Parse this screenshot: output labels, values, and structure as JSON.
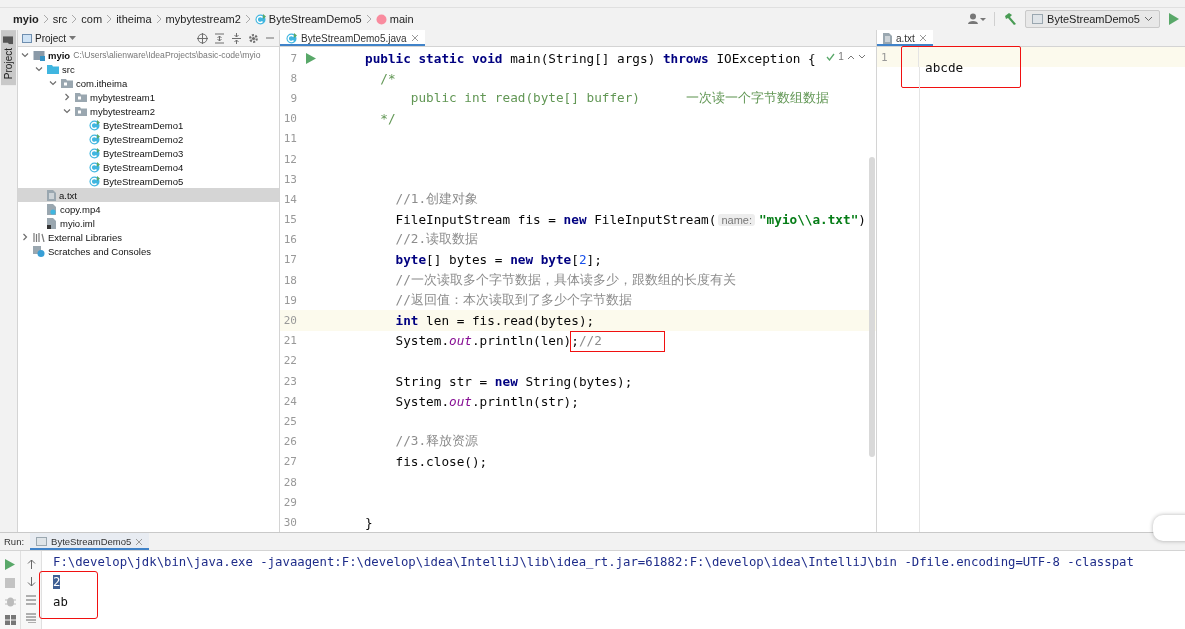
{
  "breadcrumbs": [
    {
      "label": "myio",
      "kind": "module"
    },
    {
      "label": "src",
      "kind": "folder"
    },
    {
      "label": "com",
      "kind": "folder"
    },
    {
      "label": "itheima",
      "kind": "folder"
    },
    {
      "label": "mybytestream2",
      "kind": "folder"
    },
    {
      "label": "ByteStreamDemo5",
      "kind": "class"
    },
    {
      "label": "main",
      "kind": "method"
    }
  ],
  "toolbar": {
    "run_configuration": "ByteStreamDemo5"
  },
  "side_tab": {
    "label": "Project",
    "selected": true
  },
  "project": {
    "title": "Project",
    "tree": [
      {
        "label": "myio",
        "path": "C:\\Users\\alienware\\IdeaProjects\\basic-code\\myio",
        "kind": "module",
        "expanded": true,
        "selected": false,
        "children": [
          {
            "label": "src",
            "kind": "source-folder",
            "expanded": true,
            "selected": false,
            "children": [
              {
                "label": "com.itheima",
                "kind": "package",
                "expanded": true,
                "selected": false,
                "children": [
                  {
                    "label": "mybytestream1",
                    "kind": "package",
                    "expanded": false,
                    "selected": false
                  },
                  {
                    "label": "mybytestream2",
                    "kind": "package",
                    "expanded": true,
                    "selected": false,
                    "children": [
                      {
                        "label": "ByteStreamDemo1",
                        "kind": "class",
                        "selected": false
                      },
                      {
                        "label": "ByteStreamDemo2",
                        "kind": "class",
                        "selected": false
                      },
                      {
                        "label": "ByteStreamDemo3",
                        "kind": "class",
                        "selected": false
                      },
                      {
                        "label": "ByteStreamDemo4",
                        "kind": "class",
                        "selected": false
                      },
                      {
                        "label": "ByteStreamDemo5",
                        "kind": "class",
                        "selected": false
                      }
                    ]
                  }
                ]
              }
            ]
          },
          {
            "label": "a.txt",
            "kind": "text-file",
            "selected": true
          },
          {
            "label": "copy.mp4",
            "kind": "unknown-file",
            "selected": false
          },
          {
            "label": "myio.iml",
            "kind": "module-file",
            "selected": false
          }
        ]
      },
      {
        "label": "External Libraries",
        "kind": "libraries",
        "expanded": false,
        "selected": false
      },
      {
        "label": "Scratches and Consoles",
        "kind": "scratches",
        "selected": false
      }
    ]
  },
  "editor": {
    "tabs": [
      {
        "label": "ByteStreamDemo5.java",
        "selected": true
      }
    ],
    "inspection_count": "1",
    "lines": [
      {
        "number": "7",
        "run": true,
        "current": false,
        "segments": [
          {
            "kind": "keyword",
            "text": "public static void"
          },
          {
            "kind": "plain",
            "text": " main(String[] args) "
          },
          {
            "kind": "keyword",
            "text": "throws"
          },
          {
            "kind": "plain",
            "text": " IOException {"
          }
        ]
      },
      {
        "number": "8",
        "run": false,
        "current": false,
        "segments": [
          {
            "kind": "doc",
            "text": "  /*"
          }
        ]
      },
      {
        "number": "9",
        "run": false,
        "current": false,
        "segments": [
          {
            "kind": "doc",
            "text": "      public int read(byte[] buffer)      一次读一个字节数组数据"
          }
        ]
      },
      {
        "number": "10",
        "run": false,
        "current": false,
        "segments": [
          {
            "kind": "doc",
            "text": "  */"
          }
        ]
      },
      {
        "number": "11",
        "run": false,
        "current": false
      },
      {
        "number": "12",
        "run": false,
        "current": false
      },
      {
        "number": "13",
        "run": false,
        "current": false
      },
      {
        "number": "14",
        "run": false,
        "current": false,
        "segments": [
          {
            "kind": "comment",
            "text": "    //1.创建对象"
          }
        ]
      },
      {
        "number": "15",
        "run": false,
        "current": false,
        "segments": [
          {
            "kind": "plain",
            "text": "    FileInputStream fis = "
          },
          {
            "kind": "keyword",
            "text": "new"
          },
          {
            "kind": "plain",
            "text": " FileInputStream("
          },
          {
            "kind": "hint",
            "text": "name:"
          },
          {
            "kind": "string",
            "text": "\"myio\\\\a.txt\""
          },
          {
            "kind": "plain",
            "text": ")"
          }
        ]
      },
      {
        "number": "16",
        "run": false,
        "current": false,
        "segments": [
          {
            "kind": "comment",
            "text": "    //2.读取数据"
          }
        ]
      },
      {
        "number": "17",
        "run": false,
        "current": false,
        "segments": [
          {
            "kind": "keyword",
            "text": "    byte"
          },
          {
            "kind": "plain",
            "text": "[] bytes = "
          },
          {
            "kind": "keyword",
            "text": "new byte"
          },
          {
            "kind": "plain",
            "text": "["
          },
          {
            "kind": "number",
            "text": "2"
          },
          {
            "kind": "plain",
            "text": "];"
          }
        ]
      },
      {
        "number": "18",
        "run": false,
        "current": false,
        "segments": [
          {
            "kind": "comment",
            "text": "    //一次读取多个字节数据，具体读多少，跟数组的长度有关"
          }
        ]
      },
      {
        "number": "19",
        "run": false,
        "current": false,
        "segments": [
          {
            "kind": "comment",
            "text": "    //返回值：本次读取到了多少个字节数据"
          }
        ]
      },
      {
        "number": "20",
        "run": false,
        "current": true,
        "segments": [
          {
            "kind": "keyword",
            "text": "    int"
          },
          {
            "kind": "plain",
            "text": " len = fis.read(bytes);"
          }
        ]
      },
      {
        "number": "21",
        "run": false,
        "current": false,
        "segments": [
          {
            "kind": "plain",
            "text": "    System."
          },
          {
            "kind": "field",
            "text": "out"
          },
          {
            "kind": "plain",
            "text": ".println(len)"
          },
          {
            "kind": "plain",
            "text": ";",
            "boxed": true
          },
          {
            "kind": "comment",
            "text": "//2",
            "boxed": true
          }
        ]
      },
      {
        "number": "22",
        "run": false,
        "current": false
      },
      {
        "number": "23",
        "run": false,
        "current": false,
        "segments": [
          {
            "kind": "plain",
            "text": "    String str = "
          },
          {
            "kind": "keyword",
            "text": "new"
          },
          {
            "kind": "plain",
            "text": " String(bytes);"
          }
        ]
      },
      {
        "number": "24",
        "run": false,
        "current": false,
        "segments": [
          {
            "kind": "plain",
            "text": "    System."
          },
          {
            "kind": "field",
            "text": "out"
          },
          {
            "kind": "plain",
            "text": ".println(str);"
          }
        ]
      },
      {
        "number": "25",
        "run": false,
        "current": false
      },
      {
        "number": "26",
        "run": false,
        "current": false,
        "segments": [
          {
            "kind": "comment",
            "text": "    //3.释放资源"
          }
        ]
      },
      {
        "number": "27",
        "run": false,
        "current": false,
        "segments": [
          {
            "kind": "plain",
            "text": "    fis.close();"
          }
        ]
      },
      {
        "number": "28",
        "run": false,
        "current": false
      },
      {
        "number": "29",
        "run": false,
        "current": false
      },
      {
        "number": "30",
        "run": false,
        "current": false,
        "segments": [
          {
            "kind": "plain",
            "text": "}"
          }
        ]
      }
    ]
  },
  "text_editor": {
    "tabs": [
      {
        "label": "a.txt",
        "selected": true
      }
    ],
    "lines": [
      {
        "number": "1",
        "text": "abcde",
        "boxed": true
      }
    ]
  },
  "run_panel": {
    "label": "Run:",
    "tabs": [
      {
        "label": "ByteStreamDemo5",
        "selected": true
      }
    ],
    "output": [
      {
        "kind": "command",
        "text": "F:\\develop\\jdk\\bin\\java.exe -javaagent:F:\\develop\\idea\\IntelliJ\\lib\\idea_rt.jar=61882:F:\\develop\\idea\\IntelliJ\\bin -Dfile.encoding=UTF-8 -classpat",
        "selected": false,
        "boxed": false
      },
      {
        "kind": "output",
        "text": "2",
        "selected": true,
        "boxed": true
      },
      {
        "kind": "output",
        "text": "ab",
        "selected": false,
        "boxed": true
      }
    ]
  }
}
